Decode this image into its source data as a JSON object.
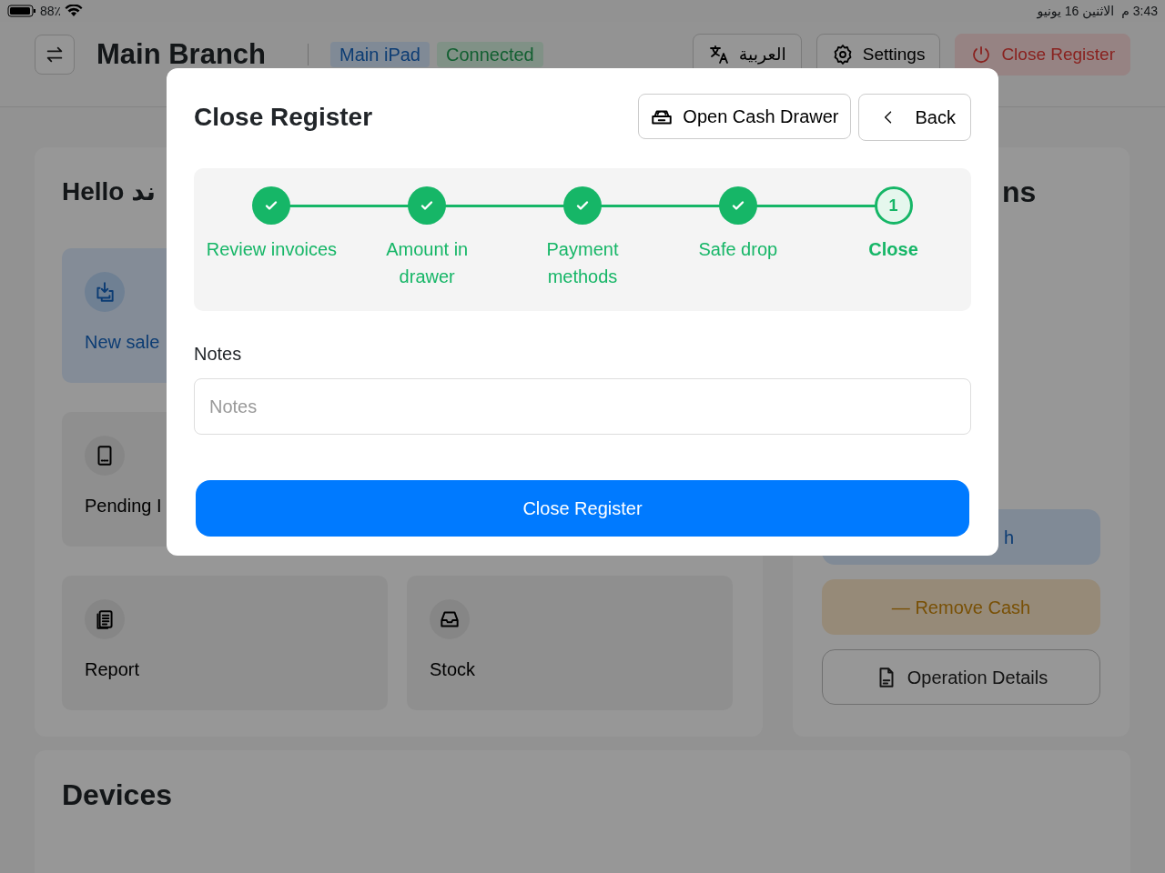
{
  "status_bar": {
    "battery": "88٪",
    "time": "3:43 م",
    "date": "الاثنين 16 يونيو"
  },
  "header": {
    "title": "Main Branch",
    "badges": [
      {
        "label": "Main iPad",
        "kind": "device"
      },
      {
        "label": "Connected",
        "kind": "status"
      }
    ],
    "actions": [
      {
        "label": "العربية",
        "kind": "language"
      },
      {
        "label": "Settings",
        "kind": "settings"
      },
      {
        "label": "Close Register",
        "kind": "danger"
      }
    ]
  },
  "dashboard": {
    "greeting": "Hello ند",
    "tiles": [
      {
        "label": "New sale",
        "kind": "sale"
      },
      {
        "label": "Pending I",
        "kind": "pending"
      },
      {
        "label": "Report",
        "kind": "report"
      },
      {
        "label": "Stock",
        "kind": "stock"
      }
    ]
  },
  "operations": {
    "title": "ns",
    "buttons": [
      {
        "label": "h",
        "kind": "add"
      },
      {
        "label": "— Remove Cash",
        "kind": "remove"
      },
      {
        "label": "Operation Details",
        "kind": "details"
      }
    ]
  },
  "devices": {
    "title": "Devices"
  },
  "modal": {
    "title": "Close Register",
    "buttons": [
      {
        "label": "Open Cash Drawer",
        "kind": "drawer"
      },
      {
        "label": "Back",
        "kind": "back"
      }
    ],
    "steps": [
      {
        "label": "Review invoices",
        "completed": true,
        "selected": false
      },
      {
        "label": "Amount in drawer",
        "completed": true,
        "selected": false
      },
      {
        "label": "Payment methods",
        "completed": true,
        "selected": false
      },
      {
        "label": "Safe drop",
        "completed": true,
        "selected": false
      },
      {
        "label": "Close",
        "completed": false,
        "selected": true,
        "number": "1"
      }
    ],
    "notes": {
      "label": "Notes",
      "placeholder": "Notes"
    },
    "submit": "Close Register"
  }
}
